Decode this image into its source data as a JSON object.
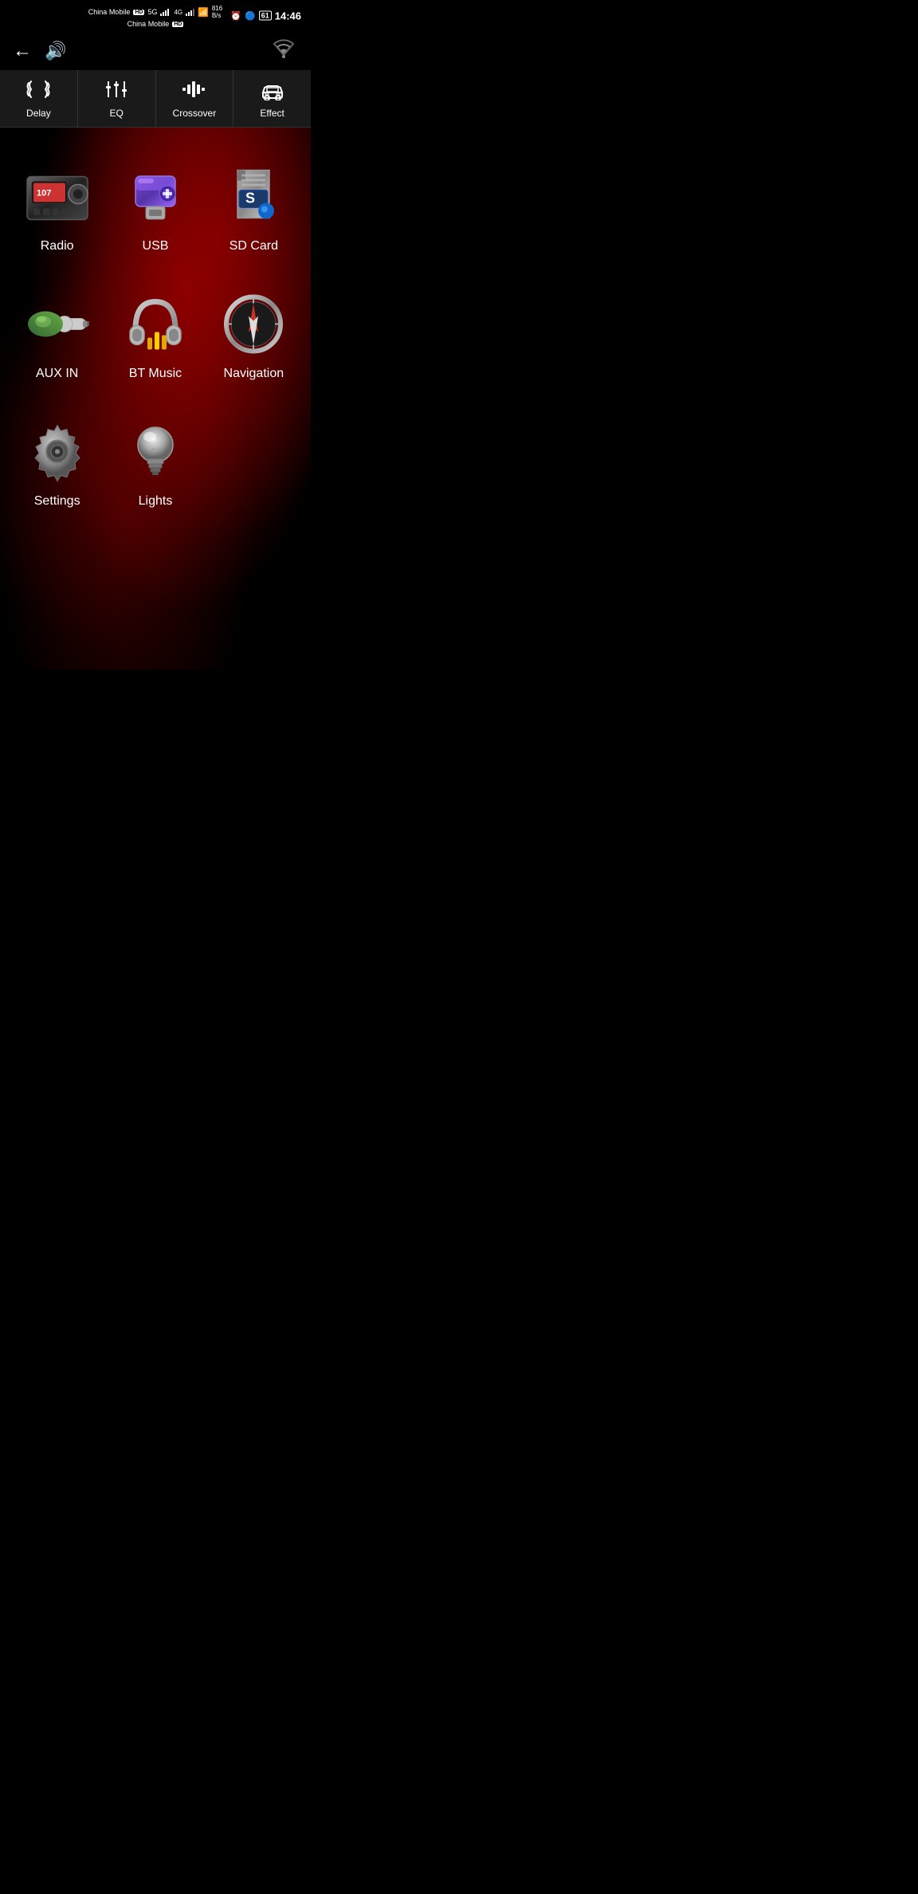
{
  "statusBar": {
    "carrier1": "China Mobile",
    "carrier2": "China Mobile",
    "hd1": "HD",
    "hd2": "HD",
    "network1": "5G",
    "network2": "4G",
    "speed": "816",
    "speedUnit": "B/s",
    "time": "14:46",
    "battery": "61"
  },
  "topNav": {
    "backLabel": "←",
    "volumeLabel": "🔊"
  },
  "tabs": [
    {
      "id": "delay",
      "label": "Delay",
      "icon": "delay"
    },
    {
      "id": "eq",
      "label": "EQ",
      "icon": "eq"
    },
    {
      "id": "crossover",
      "label": "Crossover",
      "icon": "crossover"
    },
    {
      "id": "effect",
      "label": "Effect",
      "icon": "effect"
    }
  ],
  "apps": [
    {
      "id": "radio",
      "label": "Radio"
    },
    {
      "id": "usb",
      "label": "USB"
    },
    {
      "id": "sdcard",
      "label": "SD Card"
    },
    {
      "id": "auxin",
      "label": "AUX IN"
    },
    {
      "id": "btmusic",
      "label": "BT Music"
    },
    {
      "id": "navigation",
      "label": "Navigation"
    },
    {
      "id": "settings",
      "label": "Settings"
    },
    {
      "id": "lights",
      "label": "Lights"
    }
  ]
}
